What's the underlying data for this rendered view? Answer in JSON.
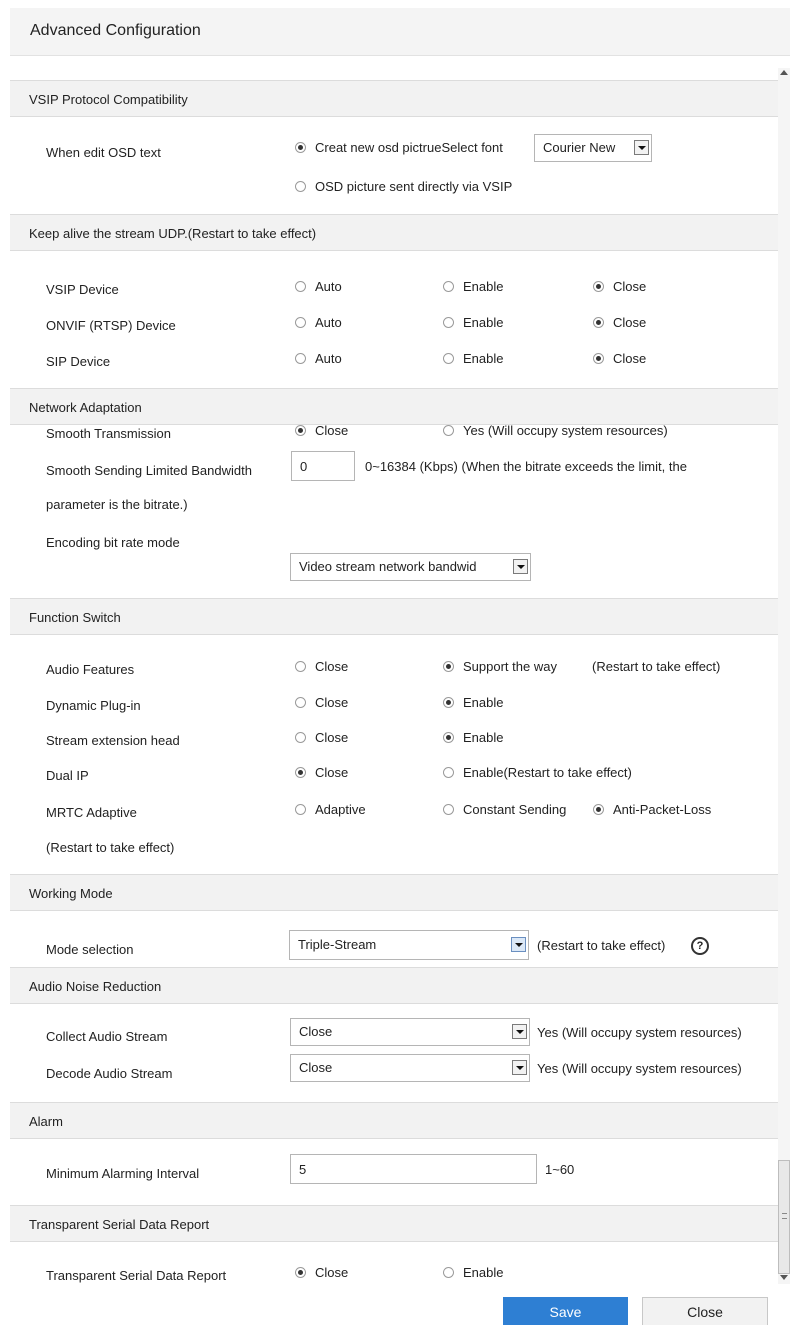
{
  "header": {
    "title": "Advanced Configuration"
  },
  "vsip": {
    "title": "VSIP Protocol Compatibility",
    "label": "When edit OSD text",
    "opt_new": "Creat new osd pictrueSelect font",
    "font": "Courier New",
    "opt_direct": "OSD picture sent directly via VSIP"
  },
  "keepalive": {
    "title": "Keep alive the stream UDP.(Restart to take effect)",
    "rows": [
      {
        "label": "VSIP Device",
        "auto": "Auto",
        "enable": "Enable",
        "close": "Close"
      },
      {
        "label": "ONVIF (RTSP) Device",
        "auto": "Auto",
        "enable": "Enable",
        "close": "Close"
      },
      {
        "label": "SIP Device",
        "auto": "Auto",
        "enable": "Enable",
        "close": "Close"
      }
    ]
  },
  "network": {
    "title": "Network Adaptation",
    "smooth_label": "Smooth Transmission",
    "smooth_close": "Close",
    "smooth_yes": "Yes (Will occupy system resources)",
    "bandwidth_label": "Smooth Sending Limited Bandwidth",
    "bandwidth_value": "0",
    "bandwidth_hint": "0~16384  (Kbps) (When the bitrate exceeds the limit, the",
    "bandwidth_hint2": "parameter is the bitrate.)",
    "encoding_label": "Encoding bit rate mode",
    "encoding_value": "Video stream network bandwid"
  },
  "function": {
    "title": "Function Switch",
    "audio_label": "Audio Features",
    "audio_close": "Close",
    "audio_support": "Support the way",
    "audio_note": "(Restart to take effect)",
    "plugin_label": "Dynamic Plug-in",
    "plugin_close": "Close",
    "plugin_enable": "Enable",
    "ext_label": "Stream extension head",
    "ext_close": "Close",
    "ext_enable": "Enable",
    "dualip_label": "Dual IP",
    "dualip_close": "Close",
    "dualip_enable": "Enable(Restart to take effect)",
    "mrtc_label": "MRTC Adaptive",
    "mrtc_note": "(Restart to take effect)",
    "mrtc_adaptive": "Adaptive",
    "mrtc_constant": "Constant Sending",
    "mrtc_anti": "Anti-Packet-Loss"
  },
  "working": {
    "title": "Working Mode",
    "label": "Mode selection",
    "value": "Triple-Stream",
    "note": "(Restart to take effect)",
    "help": "?"
  },
  "noise": {
    "title": "Audio Noise Reduction",
    "collect_label": "Collect Audio Stream",
    "collect_value": "Close",
    "collect_note": "Yes (Will occupy system resources)",
    "decode_label": "Decode Audio Stream",
    "decode_value": "Close",
    "decode_note": "Yes (Will occupy system resources)"
  },
  "alarm": {
    "title": "Alarm",
    "label": "Minimum Alarming Interval",
    "value": "5",
    "range": "1~60"
  },
  "serial": {
    "title": "Transparent Serial Data Report",
    "label": "Transparent Serial Data Report",
    "close": "Close",
    "enable": "Enable"
  },
  "buttons": {
    "save": "Save",
    "close": "Close"
  }
}
